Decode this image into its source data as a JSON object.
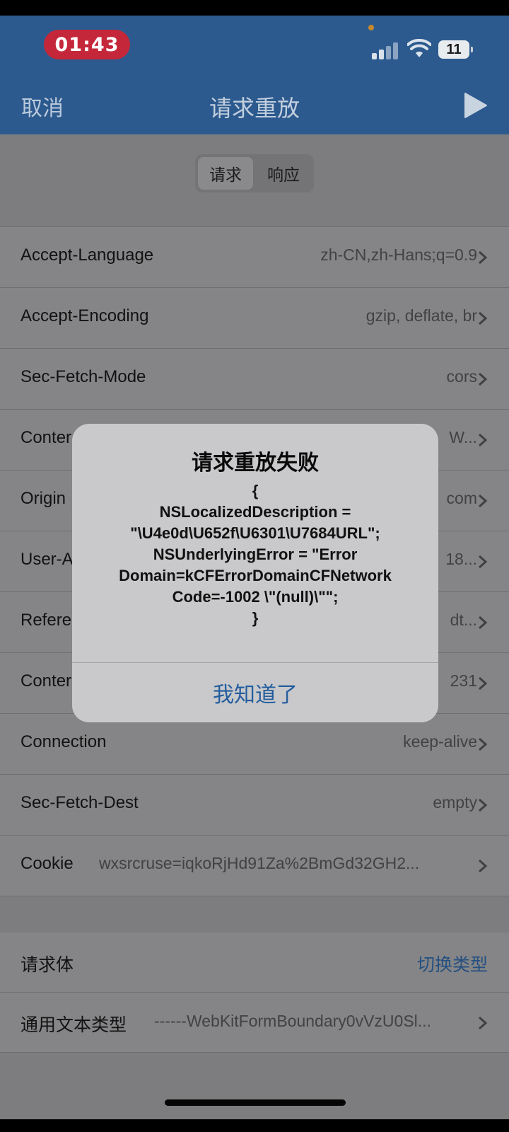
{
  "status_bar": {
    "time": "01:43",
    "battery": "11"
  },
  "nav": {
    "cancel": "取消",
    "title": "请求重放"
  },
  "segmented": {
    "request": "请求",
    "response": "响应"
  },
  "headers": [
    {
      "key": "Accept-Language",
      "value": "zh-CN,zh-Hans;q=0.9"
    },
    {
      "key": "Accept-Encoding",
      "value": "gzip, deflate, br"
    },
    {
      "key": "Sec-Fetch-Mode",
      "value": "cors"
    },
    {
      "key": "Conter",
      "value": "W..."
    },
    {
      "key": "Origin",
      "value": "com"
    },
    {
      "key": "User-A",
      "value": "18..."
    },
    {
      "key": "Refere",
      "value": "dt..."
    },
    {
      "key": "Conter",
      "value": "231"
    },
    {
      "key": "Connection",
      "value": "keep-alive"
    },
    {
      "key": "Sec-Fetch-Dest",
      "value": "empty"
    },
    {
      "key": "Cookie",
      "value": "wxsrcruse=iqkoRjHd91Za%2BmGd32GH2..."
    }
  ],
  "body": {
    "label": "请求体",
    "switch_type": "切换类型",
    "type_label": "通用文本类型",
    "type_value": "------WebKitFormBoundary0vVzU0Sl..."
  },
  "alert": {
    "title": "请求重放失败",
    "lines": [
      "{",
      "NSLocalizedDescription =",
      "\"\\U4e0d\\U652f\\U6301\\U7684URL\";",
      "NSUnderlyingError = \"Error",
      "Domain=kCFErrorDomainCFNetwork",
      "Code=-1002 \\\"(null)\\\"\";",
      "}"
    ],
    "button": "我知道了"
  }
}
